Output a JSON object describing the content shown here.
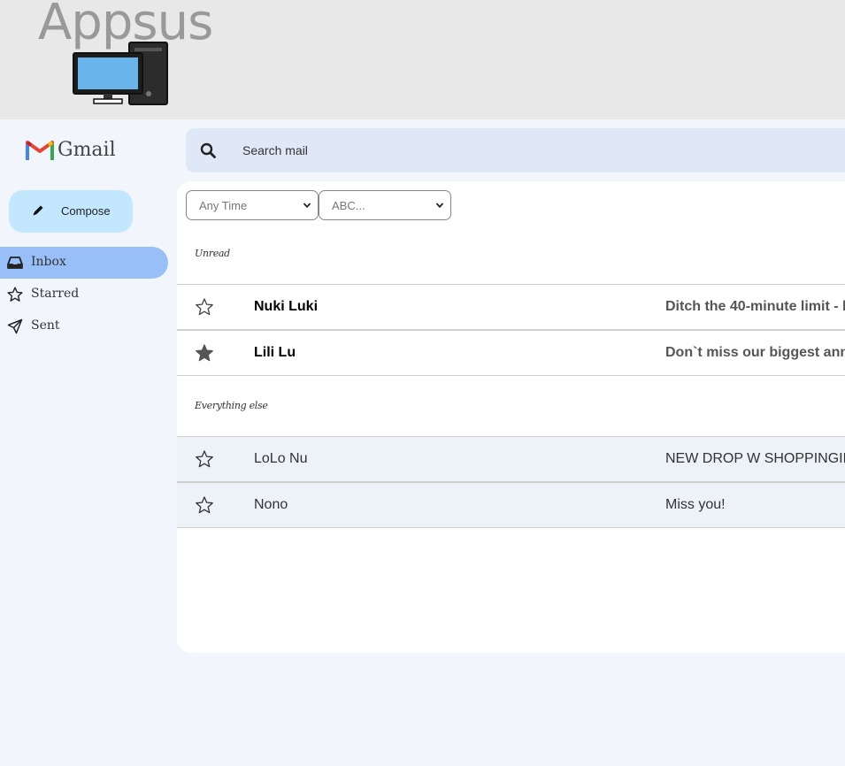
{
  "header": {
    "app_title": "Appsus"
  },
  "brand": {
    "name": "Gmail"
  },
  "search": {
    "placeholder": "Search mail"
  },
  "compose": {
    "label": "Compose"
  },
  "nav": {
    "items": [
      {
        "label": "Inbox",
        "icon": "inbox-icon",
        "active": true
      },
      {
        "label": "Starred",
        "icon": "star-icon",
        "active": false
      },
      {
        "label": "Sent",
        "icon": "send-icon",
        "active": false
      }
    ]
  },
  "filters": {
    "time": {
      "selected": "Any Time"
    },
    "sort": {
      "selected": "ABC..."
    }
  },
  "sections": {
    "unread_label": "Unread",
    "else_label": "Everything else"
  },
  "mails": {
    "unread": [
      {
        "sender": "Nuki Luki",
        "subject": "Ditch the 40-minute limit - b",
        "starred": false
      },
      {
        "sender": "Lili Lu",
        "subject": "Don`t miss our biggest ann",
        "starred": true
      }
    ],
    "read": [
      {
        "sender": "LoLo Nu",
        "subject": "NEW DROP W SHOPPINGIL",
        "starred": false
      },
      {
        "sender": "Nono",
        "subject": "Miss you!",
        "starred": false
      }
    ]
  },
  "colors": {
    "header_bg": "#e8e8e8",
    "page_bg": "#f2f6fc",
    "search_bg": "#dfe8f6",
    "compose_bg": "#c2e7ff",
    "nav_active_bg": "#99bff8",
    "read_row_bg": "#edf1f8"
  }
}
